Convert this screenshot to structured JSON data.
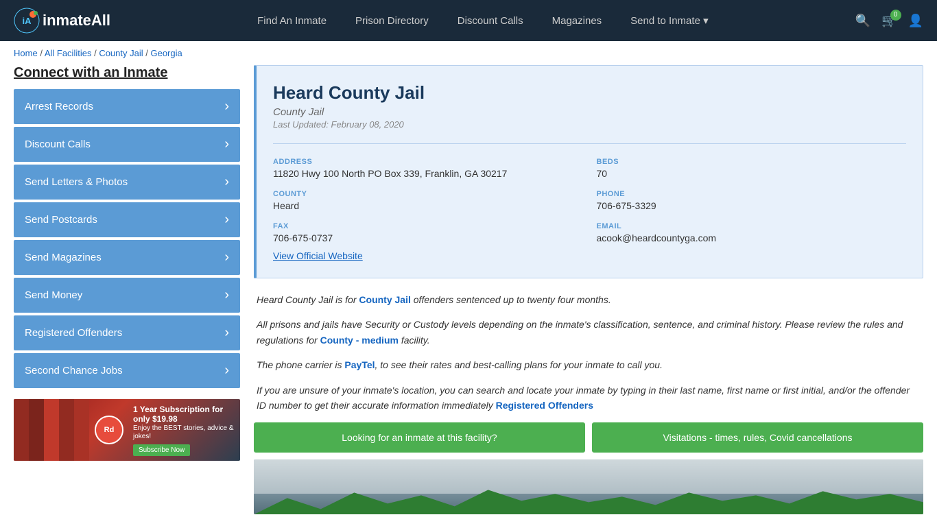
{
  "header": {
    "logo_text": "inmateAll",
    "nav_items": [
      {
        "label": "Find An Inmate",
        "id": "find-inmate"
      },
      {
        "label": "Prison Directory",
        "id": "prison-directory"
      },
      {
        "label": "Discount Calls",
        "id": "discount-calls"
      },
      {
        "label": "Magazines",
        "id": "magazines"
      },
      {
        "label": "Send to Inmate ▾",
        "id": "send-to-inmate"
      }
    ],
    "cart_badge": "0"
  },
  "breadcrumb": {
    "home": "Home",
    "sep1": " / ",
    "all_facilities": "All Facilities",
    "sep2": " / ",
    "county_jail": "County Jail",
    "sep3": " / ",
    "state": "Georgia"
  },
  "sidebar": {
    "title": "Connect with an Inmate",
    "items": [
      {
        "label": "Arrest Records"
      },
      {
        "label": "Discount Calls"
      },
      {
        "label": "Send Letters & Photos"
      },
      {
        "label": "Send Postcards"
      },
      {
        "label": "Send Magazines"
      },
      {
        "label": "Send Money"
      },
      {
        "label": "Registered Offenders"
      },
      {
        "label": "Second Chance Jobs"
      }
    ],
    "ad": {
      "badge": "Rd",
      "headline": "1 Year Subscription for only $19.98",
      "sub": "Enjoy the BEST stories, advice & jokes!",
      "button": "Subscribe Now"
    }
  },
  "facility": {
    "name": "Heard County Jail",
    "type": "County Jail",
    "last_updated": "Last Updated: February 08, 2020",
    "address_label": "ADDRESS",
    "address_value": "11820 Hwy 100 North PO Box 339, Franklin, GA 30217",
    "beds_label": "BEDS",
    "beds_value": "70",
    "county_label": "COUNTY",
    "county_value": "Heard",
    "phone_label": "PHONE",
    "phone_value": "706-675-3329",
    "fax_label": "FAX",
    "fax_value": "706-675-0737",
    "email_label": "EMAIL",
    "email_value": "acook@heardcountyga.com",
    "website_link": "View Official Website",
    "desc1": "Heard County Jail is for County Jail offenders sentenced up to twenty four months.",
    "desc2": "All prisons and jails have Security or Custody levels depending on the inmate's classification, sentence, and criminal history. Please review the rules and regulations for County - medium facility.",
    "desc3": "The phone carrier is PayTel, to see their rates and best-calling plans for your inmate to call you.",
    "desc4": "If you are unsure of your inmate's location, you can search and locate your inmate by typing in their last name, first name or first initial, and/or the offender ID number to get their accurate information immediately Registered Offenders",
    "btn1": "Looking for an inmate at this facility?",
    "btn2": "Visitations - times, rules, Covid cancellations"
  }
}
